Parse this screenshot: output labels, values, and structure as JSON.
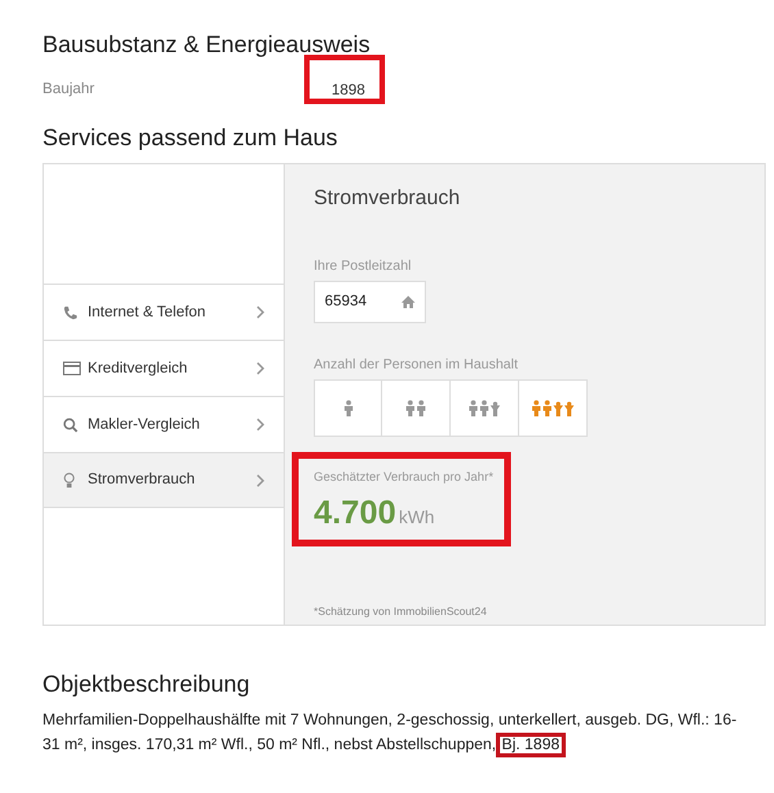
{
  "building": {
    "heading": "Bausubstanz & Energieausweis",
    "rows": [
      {
        "label": "Baujahr",
        "value": "1898",
        "highlighted": true
      }
    ]
  },
  "services": {
    "heading": "Services passend zum Haus",
    "menu": [
      {
        "label": "Internet & Telefon",
        "selected": false
      },
      {
        "label": "Kreditvergleich",
        "selected": false
      },
      {
        "label": "Makler-Vergleich",
        "selected": false
      },
      {
        "label": "Stromverbrauch",
        "selected": true
      }
    ],
    "panel": {
      "title": "Stromverbrauch",
      "zip_label": "Ihre Postleitzahl",
      "zip_value": "65934",
      "persons_label": "Anzahl der Personen im Haushalt",
      "persons": [
        {
          "selected": false
        },
        {
          "selected": false
        },
        {
          "selected": false
        },
        {
          "selected": true
        }
      ],
      "estimate_label": "Geschätzter Verbrauch pro Jahr*",
      "estimate_value": "4.700",
      "estimate_unit": "kWh",
      "estimate_highlighted": true,
      "footnote": "*Schätzung von ImmobilienScout24"
    }
  },
  "description": {
    "heading": "Objektbeschreibung",
    "text": "Mehrfamilien-Doppelhaushälfte mit 7 Wohnungen, 2-geschossig, unterkellert, ausgeb. DG, Wfl.: 16-31 m², insges. 170,31 m² Wfl., 50 m² Nfl., nebst Abstellschuppen, ",
    "highlight": "Bj. 1898"
  }
}
